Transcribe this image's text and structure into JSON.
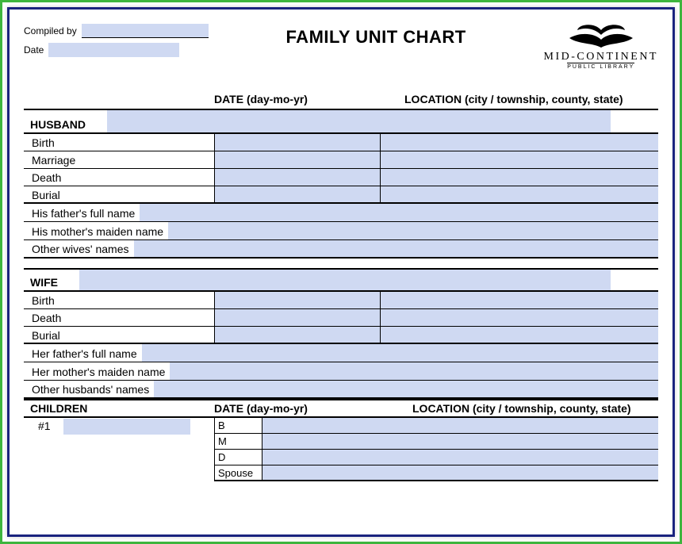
{
  "header": {
    "compiled_by_label": "Compiled by",
    "compiled_by_value": "",
    "date_label": "Date",
    "date_value": "",
    "title": "FAMILY UNIT CHART",
    "logo_main": "MID-CONTINENT",
    "logo_sub": "PUBLIC LIBRARY"
  },
  "col_headers": {
    "date": "DATE (day-mo-yr)",
    "location": "LOCATION (city / township, county, state)"
  },
  "husband": {
    "label": "HUSBAND",
    "name": "",
    "rows": {
      "birth": "Birth",
      "marriage": "Marriage",
      "death": "Death",
      "burial": "Burial"
    },
    "birth_date": "",
    "birth_loc": "",
    "marriage_date": "",
    "marriage_loc": "",
    "death_date": "",
    "death_loc": "",
    "burial_date": "",
    "burial_loc": "",
    "parents": {
      "father_lbl": "His father's full name",
      "father_val": "",
      "mother_lbl": "His mother's maiden name",
      "mother_val": "",
      "other_lbl": "Other wives' names",
      "other_val": ""
    }
  },
  "wife": {
    "label": "WIFE",
    "name": "",
    "rows": {
      "birth": "Birth",
      "death": "Death",
      "burial": "Burial"
    },
    "birth_date": "",
    "birth_loc": "",
    "death_date": "",
    "death_loc": "",
    "burial_date": "",
    "burial_loc": "",
    "parents": {
      "father_lbl": "Her father's full name",
      "father_val": "",
      "mother_lbl": "Her mother's maiden name",
      "mother_val": "",
      "other_lbl": "Other husbands' names",
      "other_val": ""
    }
  },
  "children": {
    "label": "CHILDREN",
    "date_header": "DATE (day-mo-yr)",
    "loc_header": "LOCATION (city / township, county, state)",
    "num1": "#1",
    "name1": "",
    "row_b": "B",
    "row_m": "M",
    "row_d": "D",
    "row_spouse": "Spouse",
    "b_date": "",
    "b_loc": "",
    "m_date": "",
    "m_loc": "",
    "d_date": "",
    "d_loc": "",
    "spouse_val": ""
  }
}
